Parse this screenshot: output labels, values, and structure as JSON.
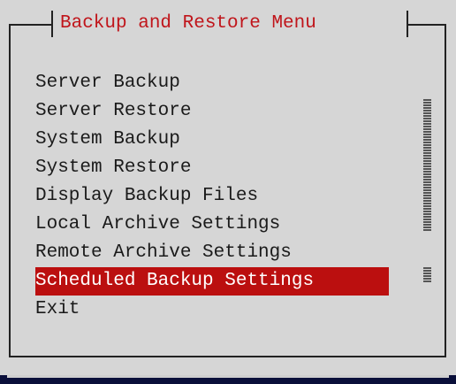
{
  "dialog": {
    "title": "Backup and Restore Menu"
  },
  "menu": {
    "items": [
      {
        "label": "Server Backup"
      },
      {
        "label": "Server Restore"
      },
      {
        "label": "System Backup"
      },
      {
        "label": "System Restore"
      },
      {
        "label": "Display Backup Files"
      },
      {
        "label": "Local Archive Settings"
      },
      {
        "label": "Remote Archive Settings"
      },
      {
        "label": "Scheduled Backup Settings",
        "selected": true
      },
      {
        "label": "Exit"
      }
    ]
  },
  "colors": {
    "title": "#c0151b",
    "selection_background": "#bb0f0f",
    "selection_text": "#ffffff",
    "background": "#d6d6d6",
    "text": "#1a1a1a"
  },
  "icons": {
    "scroll_track": "hatched-scroll-indicator"
  }
}
